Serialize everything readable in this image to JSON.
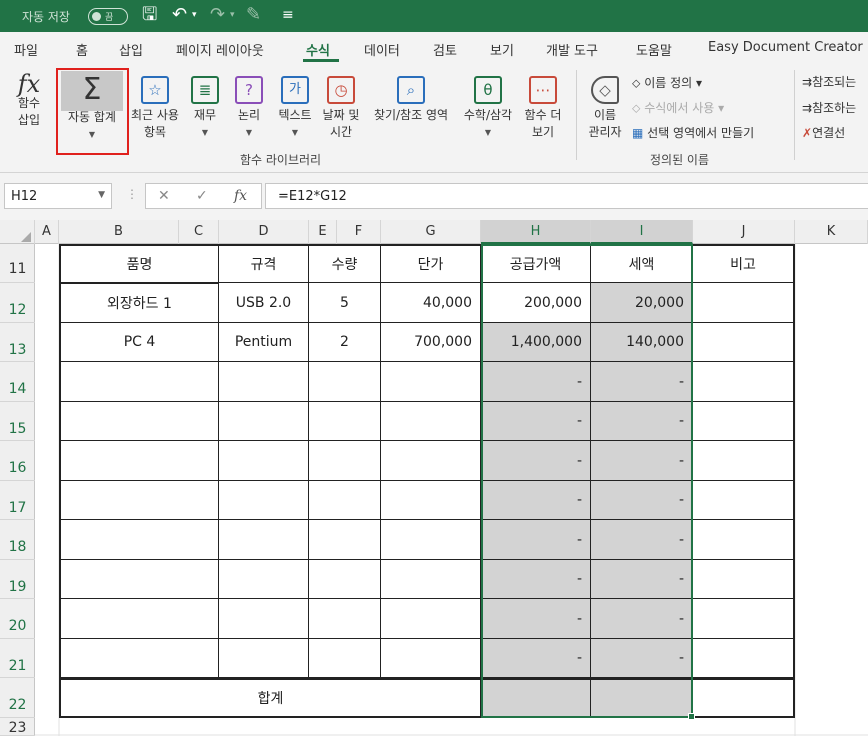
{
  "titlebar": {
    "autosave_label": "자동 저장",
    "autosave_state": "끔"
  },
  "menu": {
    "tabs": [
      "파일",
      "홈",
      "삽입",
      "페이지 레이아웃",
      "수식",
      "데이터",
      "검토",
      "보기",
      "개발 도구",
      "도움말",
      "Easy Document Creator"
    ],
    "active": "수식"
  },
  "ribbon": {
    "function_library": {
      "insert_function": "함수\n삽입",
      "autosum": "자동 합계",
      "recent": "최근 사용\n항목",
      "financial": "재무",
      "logical": "논리",
      "text": "텍스트",
      "datetime": "날짜 및\n시간",
      "lookup": "찾기/참조 영역",
      "math": "수학/삼각",
      "more": "함수 더\n보기",
      "group_label": "함수 라이브러리"
    },
    "defined_names": {
      "name_manager": "이름\n관리자",
      "define_name": "이름 정의",
      "use_in_formula": "수식에서 사용",
      "create_from_selection": "선택 영역에서 만들기",
      "group_label": "정의된 이름"
    },
    "auditing": {
      "trace_precedents": "참조되는",
      "trace_dependents": "참조하는",
      "remove_arrows": "연결선"
    }
  },
  "formula_bar": {
    "name_box": "H12",
    "formula": "=E12*G12"
  },
  "sheet": {
    "columns": [
      "A",
      "B",
      "C",
      "D",
      "E",
      "F",
      "G",
      "H",
      "I",
      "J",
      "K"
    ],
    "selected_columns": [
      "H",
      "I"
    ],
    "rows": [
      "11",
      "12",
      "13",
      "14",
      "15",
      "16",
      "17",
      "18",
      "19",
      "20",
      "21",
      "22",
      "23"
    ],
    "headers": {
      "item": "품명",
      "spec": "규격",
      "qty": "수량",
      "price": "단가",
      "supply": "공급가액",
      "tax": "세액",
      "note": "비고"
    },
    "data": [
      {
        "item": "외장하드 1",
        "spec": "USB 2.0",
        "qty": "5",
        "price": "40,000",
        "supply": "200,000",
        "tax": "20,000"
      },
      {
        "item": "PC 4",
        "spec": "Pentium",
        "qty": "2",
        "price": "700,000",
        "supply": "1,400,000",
        "tax": "140,000"
      }
    ],
    "empty_dash": "-",
    "total_label": "합계"
  }
}
